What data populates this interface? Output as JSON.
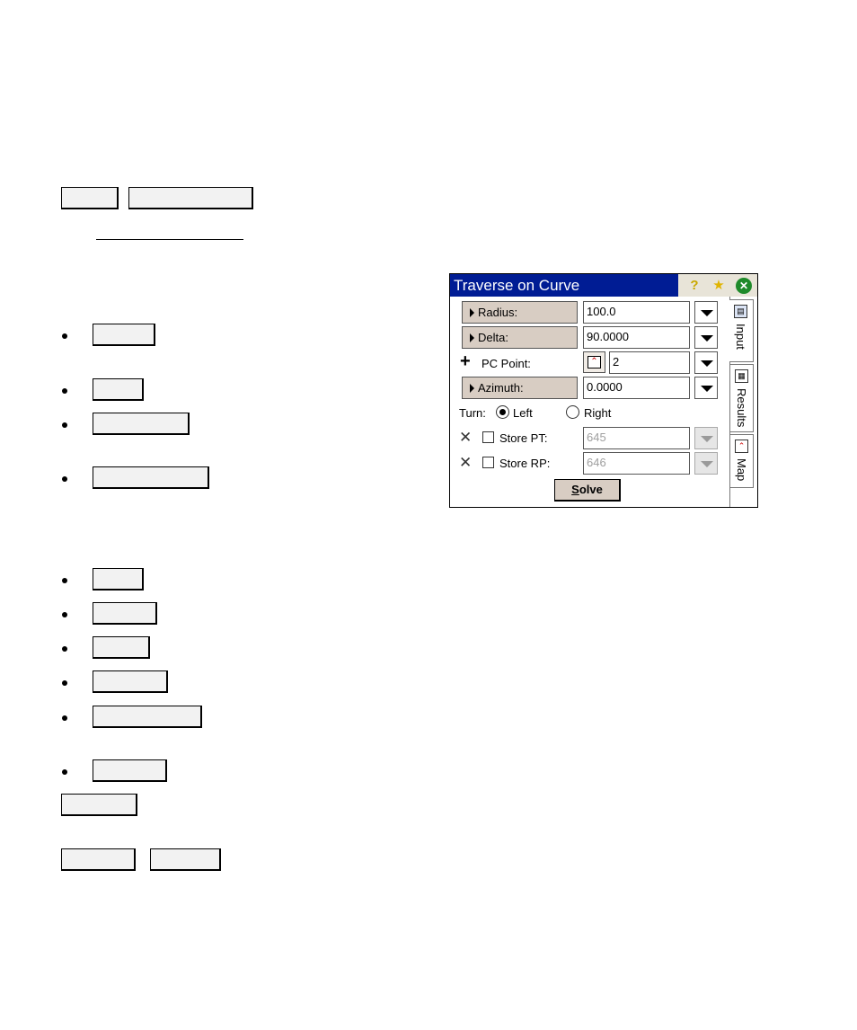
{
  "dialog": {
    "title": "Traverse on Curve",
    "title_bar_icons": [
      "help-icon",
      "favorites-star-icon",
      "close-icon"
    ],
    "rows": {
      "radius": {
        "label": "Radius:",
        "value": "100.0"
      },
      "delta": {
        "label": "Delta:",
        "value": "90.0000"
      },
      "pc_point": {
        "label": "PC Point:",
        "value": "2"
      },
      "azimuth": {
        "label": "Azimuth:",
        "value": "0.0000"
      }
    },
    "turn": {
      "label": "Turn:",
      "left": "Left",
      "right": "Right",
      "selected": "Left"
    },
    "store_pt": {
      "label": "Store PT:",
      "value": "645",
      "checked": false
    },
    "store_rp": {
      "label": "Store RP:",
      "value": "646",
      "checked": false
    },
    "solve_label_first": "S",
    "solve_label_rest": "olve",
    "tabs": [
      {
        "label": "Input",
        "icon": "input-form-icon",
        "active": true
      },
      {
        "label": "Results",
        "icon": "results-sheet-icon",
        "active": false
      },
      {
        "label": "Map",
        "icon": "map-icon",
        "active": false
      }
    ]
  },
  "colors": {
    "title_bar": "#001c94",
    "label_button": "#d8cdc3"
  }
}
